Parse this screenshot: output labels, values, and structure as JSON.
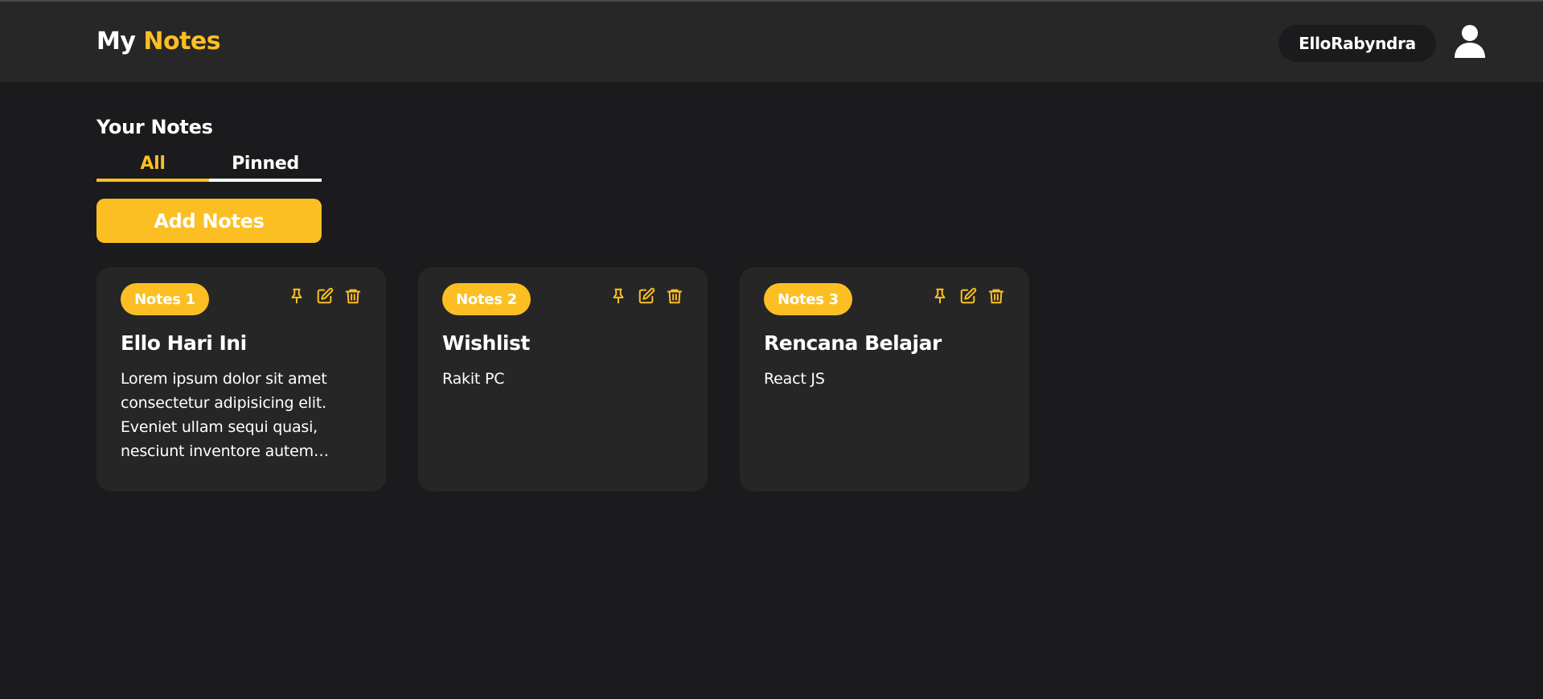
{
  "header": {
    "brand_prefix": "My",
    "brand_accent": "Notes",
    "username": "ElloRabyndra",
    "avatar_icon": "user-icon"
  },
  "main": {
    "section_title": "Your Notes",
    "tabs": [
      {
        "label": "All",
        "active": true
      },
      {
        "label": "Pinned",
        "active": false
      }
    ],
    "add_button_label": "Add Notes"
  },
  "notes": [
    {
      "badge": "Notes 1",
      "title": "Ello Hari Ini",
      "body": "Lorem ipsum dolor sit amet consectetur adipisicing elit. Eveniet ullam sequi quasi, nesciunt inventore autem voluptatum"
    },
    {
      "badge": "Notes 2",
      "title": "Wishlist",
      "body": "Rakit PC"
    },
    {
      "badge": "Notes 3",
      "title": "Rencana Belajar",
      "body": "React JS"
    }
  ],
  "icons": {
    "pin": "pin-icon",
    "edit": "edit-icon",
    "delete": "trash-icon"
  },
  "colors": {
    "accent": "#fbbf24",
    "background": "#1b1b1d",
    "surface": "#272727",
    "card": "#262626"
  }
}
